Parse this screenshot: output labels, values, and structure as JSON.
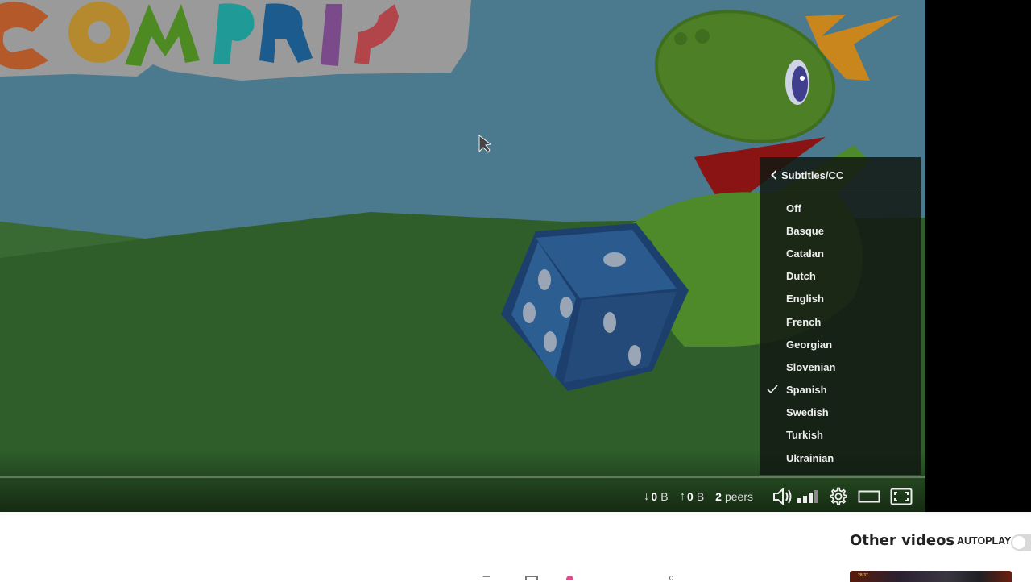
{
  "player": {
    "video_title_art": "COMPRIS",
    "stats": {
      "download_value": "0",
      "download_unit": "B",
      "upload_value": "0",
      "upload_unit": "B",
      "peers_count": "2",
      "peers_label": "peers"
    },
    "volume_level": 0.75,
    "buffer_progress_percent": 100,
    "icons": {
      "download": "arrow-down-icon",
      "upload": "arrow-up-icon",
      "volume": "volume-icon",
      "volume_bars": "volume-level-icon",
      "settings": "gear-icon",
      "theater": "theater-mode-icon",
      "fullscreen": "fullscreen-icon"
    }
  },
  "subtitles_menu": {
    "title": "Subtitles/CC",
    "selected": "Spanish",
    "options": [
      {
        "label": "Off",
        "selected": false
      },
      {
        "label": "Basque",
        "selected": false
      },
      {
        "label": "Catalan",
        "selected": false
      },
      {
        "label": "Dutch",
        "selected": false
      },
      {
        "label": "English",
        "selected": false
      },
      {
        "label": "French",
        "selected": false
      },
      {
        "label": "Georgian",
        "selected": false
      },
      {
        "label": "Slovenian",
        "selected": false
      },
      {
        "label": "Spanish",
        "selected": true
      },
      {
        "label": "Swedish",
        "selected": false
      },
      {
        "label": "Turkish",
        "selected": false
      },
      {
        "label": "Ukrainian",
        "selected": false
      }
    ]
  },
  "sidebar": {
    "other_videos_title": "Other videos",
    "autoplay_label": "AUTOPLAY",
    "autoplay_enabled": false,
    "thumbnail_duration": "28:37"
  },
  "colors": {
    "accent_pink": "#e8478b",
    "menu_bg": "#121812"
  }
}
